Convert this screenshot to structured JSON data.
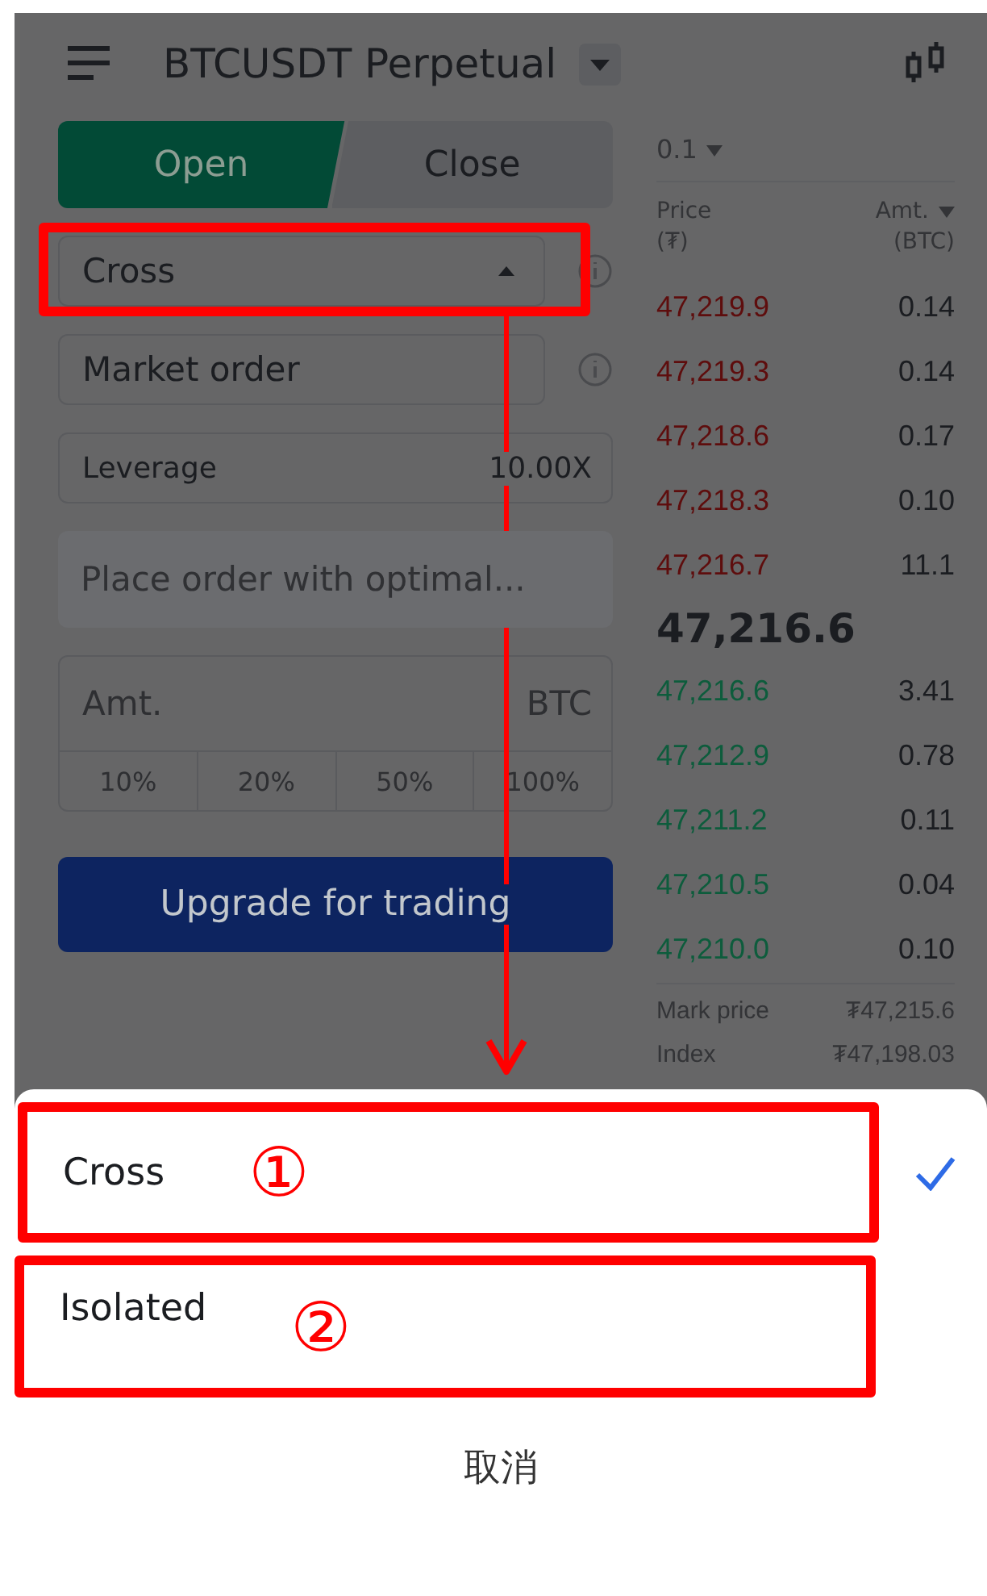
{
  "header": {
    "title": "BTCUSDT Perpetual"
  },
  "tabs": [
    {
      "label": "Open",
      "selected": true
    },
    {
      "label": "Close",
      "selected": false
    }
  ],
  "margin_mode": {
    "value": "Cross",
    "expanded": true,
    "highlighted": true
  },
  "order_type": {
    "value": "Market order"
  },
  "leverage": {
    "label": "Leverage",
    "value": "10.00X"
  },
  "price_field": {
    "placeholder": "Place order with optimal..."
  },
  "amount_field": {
    "placeholder": "Amt.",
    "unit": "BTC"
  },
  "percent_buttons": [
    "10%",
    "20%",
    "50%",
    "100%"
  ],
  "submit_button": "Upgrade for trading",
  "order_book": {
    "tick_size": "0.1",
    "price_header": {
      "label": "Price",
      "unit": "(₮)"
    },
    "amount_header": {
      "label": "Amt.",
      "unit": "(BTC)"
    },
    "asks": [
      {
        "price": "47,219.9",
        "amount": "0.14"
      },
      {
        "price": "47,219.3",
        "amount": "0.14"
      },
      {
        "price": "47,218.6",
        "amount": "0.17"
      },
      {
        "price": "47,218.3",
        "amount": "0.10"
      },
      {
        "price": "47,216.7",
        "amount": "11.1"
      }
    ],
    "last_price": "47,216.6",
    "bids": [
      {
        "price": "47,216.6",
        "amount": "3.41"
      },
      {
        "price": "47,212.9",
        "amount": "0.78"
      },
      {
        "price": "47,211.2",
        "amount": "0.11"
      },
      {
        "price": "47,210.5",
        "amount": "0.04"
      },
      {
        "price": "47,210.0",
        "amount": "0.10"
      }
    ],
    "stats": [
      {
        "label": "Mark price",
        "value": "₮47,215.6"
      },
      {
        "label": "Index",
        "value": "₮47,198.03"
      }
    ]
  },
  "sheet": {
    "options": [
      {
        "label": "Cross",
        "selected": true,
        "highlighted": true,
        "annotation": "①"
      },
      {
        "label": "Isolated",
        "selected": false,
        "highlighted": true,
        "annotation": "②"
      }
    ],
    "cancel": "取消"
  }
}
